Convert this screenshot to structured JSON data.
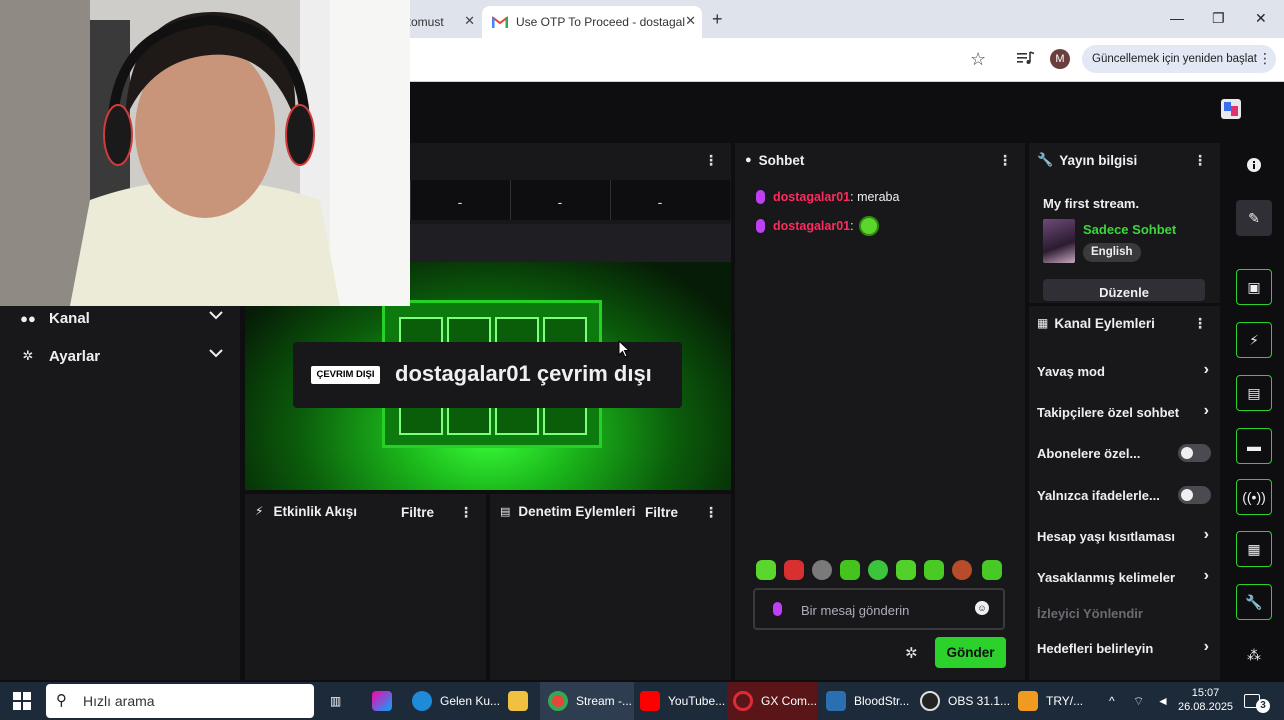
{
  "browser": {
    "tabs": [
      {
        "label": "komust"
      },
      {
        "label": "Use OTP To Proceed - dostagal"
      }
    ],
    "new_tab": "+",
    "window_controls": {
      "minimize": "—",
      "maximize": "❐",
      "close": "✕"
    },
    "profile_initial": "M",
    "update_button": "Güncellemek için yeniden başlat"
  },
  "left_nav": {
    "items": [
      {
        "label": "Kanal",
        "icon": "users-icon"
      },
      {
        "label": "Ayarlar",
        "icon": "gear-icon"
      }
    ]
  },
  "stream_panel": {
    "stats": [
      "-",
      "-",
      "-"
    ],
    "offline_badge": "ÇEVRIM DIŞI",
    "offline_title": "dostagalar01 çevrim dışı"
  },
  "activity_feed": {
    "title": "Etkinlik Akışı",
    "filter": "Filtre"
  },
  "mod_actions": {
    "title": "Denetim Eylemleri",
    "filter": "Filtre"
  },
  "chat": {
    "title": "Sohbet",
    "messages": [
      {
        "user": "dostagalar01",
        "text": ": meraba"
      },
      {
        "user": "dostagalar01",
        "text": ":"
      }
    ],
    "placeholder": "Bir mesaj gönderin",
    "send_label": "Gönder"
  },
  "stream_info": {
    "title": "Yayın bilgisi",
    "stream_title": "My first stream.",
    "category": "Sadece Sohbet",
    "language": "English",
    "edit_label": "Düzenle"
  },
  "channel_actions": {
    "title": "Kanal Eylemleri",
    "items": [
      {
        "label": "Yavaş mod",
        "control": "arrow"
      },
      {
        "label": "Takipçilere özel sohbet",
        "control": "arrow"
      },
      {
        "label": "Abonelere özel...",
        "control": "toggle"
      },
      {
        "label": "Yalnızca ifadelerle...",
        "control": "toggle"
      },
      {
        "label": "Hesap yaşı kısıtlaması",
        "control": "arrow"
      },
      {
        "label": "Yasaklanmış kelimeler",
        "control": "arrow"
      },
      {
        "label": "İzleyici Yönlendir",
        "control": "none"
      },
      {
        "label": "Hedefleri belirleyin",
        "control": "arrow"
      }
    ]
  },
  "taskbar": {
    "search_text": "Hızlı arama",
    "apps": [
      {
        "label": "Gelen Ku..."
      },
      {
        "label": "Stream -..."
      },
      {
        "label": "YouTube..."
      },
      {
        "label": "GX Com..."
      },
      {
        "label": "BloodStr..."
      },
      {
        "label": "OBS 31.1..."
      },
      {
        "label": "TRY/..."
      }
    ],
    "time": "15:07",
    "date": "26.08.2025",
    "notification_count": "3"
  },
  "colors": {
    "accent_green": "#2cd12c",
    "username_red": "#ff2a5e",
    "mic_purple": "#bf3ff5",
    "background": "#0e0e10",
    "panel": "#18181b"
  }
}
